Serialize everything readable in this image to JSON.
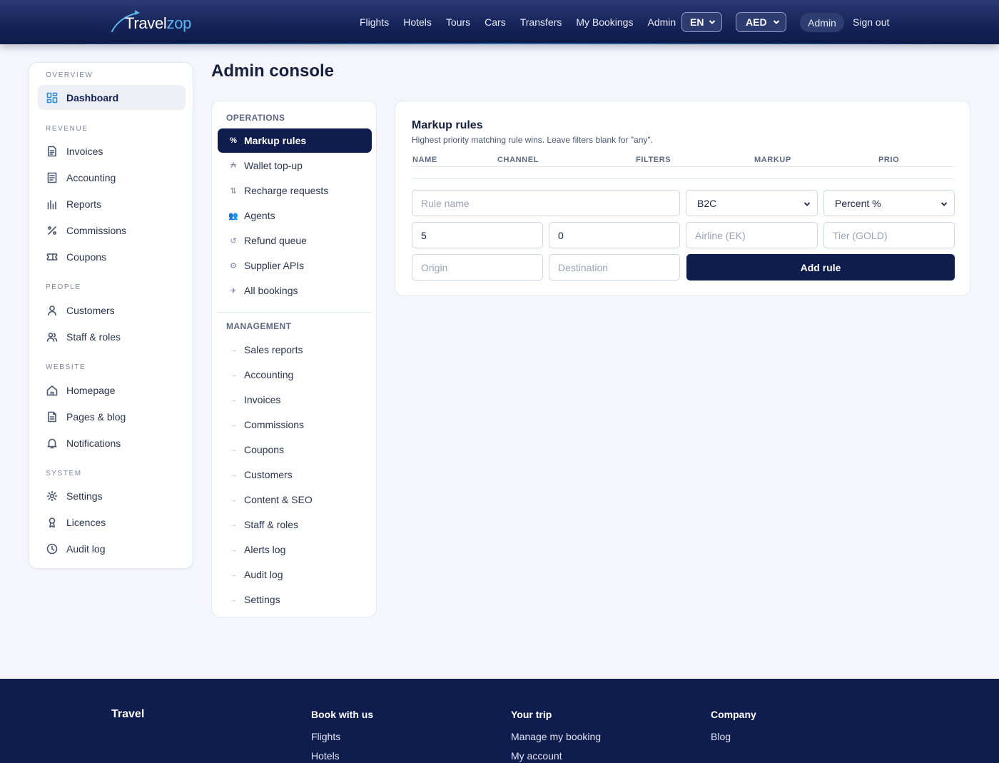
{
  "brand": {
    "name_part1": "Travel",
    "name_part2": "zop"
  },
  "nav": {
    "links": [
      "Flights",
      "Hotels",
      "Tours",
      "Cars",
      "Transfers",
      "My Bookings",
      "Admin"
    ],
    "language": "EN",
    "currency": "AED",
    "user": "Admin",
    "signout": "Sign out"
  },
  "sidebar": {
    "sections": [
      {
        "title": "OVERVIEW",
        "items": [
          {
            "label": "Dashboard",
            "icon": "dashboard-icon",
            "active": true
          }
        ]
      },
      {
        "title": "REVENUE",
        "items": [
          {
            "label": "Invoices",
            "icon": "invoice-icon"
          },
          {
            "label": "Accounting",
            "icon": "ledger-icon"
          },
          {
            "label": "Reports",
            "icon": "bar-chart-icon"
          },
          {
            "label": "Commissions",
            "icon": "percent-icon"
          },
          {
            "label": "Coupons",
            "icon": "ticket-icon"
          }
        ]
      },
      {
        "title": "PEOPLE",
        "items": [
          {
            "label": "Customers",
            "icon": "user-icon"
          },
          {
            "label": "Staff & roles",
            "icon": "users-icon"
          }
        ]
      },
      {
        "title": "WEBSITE",
        "items": [
          {
            "label": "Homepage",
            "icon": "home-icon"
          },
          {
            "label": "Pages & blog",
            "icon": "page-icon"
          },
          {
            "label": "Notifications",
            "icon": "bell-icon"
          }
        ]
      },
      {
        "title": "SYSTEM",
        "items": [
          {
            "label": "Settings",
            "icon": "gear-icon"
          },
          {
            "label": "Licences",
            "icon": "badge-icon"
          },
          {
            "label": "Audit log",
            "icon": "clock-icon"
          }
        ]
      }
    ]
  },
  "page": {
    "title": "Admin console"
  },
  "ops_nav": {
    "operations_title": "OPERATIONS",
    "operations": [
      {
        "label": "Markup rules",
        "glyph": "%",
        "icon": "percent-icon",
        "active": true
      },
      {
        "label": "Wallet top-up",
        "glyph": "₳",
        "icon": "wallet-icon"
      },
      {
        "label": "Recharge requests",
        "glyph": "⇅",
        "icon": "swap-icon"
      },
      {
        "label": "Agents",
        "glyph": "👥",
        "icon": "agents-icon"
      },
      {
        "label": "Refund queue",
        "glyph": "↺",
        "icon": "refund-icon"
      },
      {
        "label": "Supplier APIs",
        "glyph": "⚙",
        "icon": "gear-icon"
      },
      {
        "label": "All bookings",
        "glyph": "✈",
        "icon": "plane-icon"
      }
    ],
    "management_title": "MANAGEMENT",
    "management": [
      "Sales reports",
      "Accounting",
      "Invoices",
      "Commissions",
      "Coupons",
      "Customers",
      "Content & SEO",
      "Staff & roles",
      "Alerts log",
      "Audit log",
      "Settings"
    ],
    "arrow_glyph": "→"
  },
  "markup": {
    "title": "Markup rules",
    "subtitle": "Highest priority matching rule wins. Leave filters blank for \"any\".",
    "columns": [
      "NAME",
      "CHANNEL",
      "FILTERS",
      "MARKUP",
      "PRIO"
    ],
    "form": {
      "rule_name_placeholder": "Rule name",
      "channel": "B2C",
      "markup_type": "Percent %",
      "value": "5",
      "priority": "0",
      "airline_placeholder": "Airline (EK)",
      "tier_placeholder": "Tier (GOLD)",
      "origin_placeholder": "Origin",
      "destination_placeholder": "Destination",
      "add_button": "Add rule"
    }
  },
  "footer": {
    "brand": "Travel",
    "columns": [
      {
        "title": "Book with us",
        "links": [
          "Flights",
          "Hotels"
        ]
      },
      {
        "title": "Your trip",
        "links": [
          "Manage my booking",
          "My account"
        ]
      },
      {
        "title": "Company",
        "links": [
          "Blog"
        ]
      }
    ]
  },
  "colors": {
    "primary": "#0e1c4e",
    "accent": "#2e8fd6",
    "logo_accent": "#5ab8ef"
  }
}
